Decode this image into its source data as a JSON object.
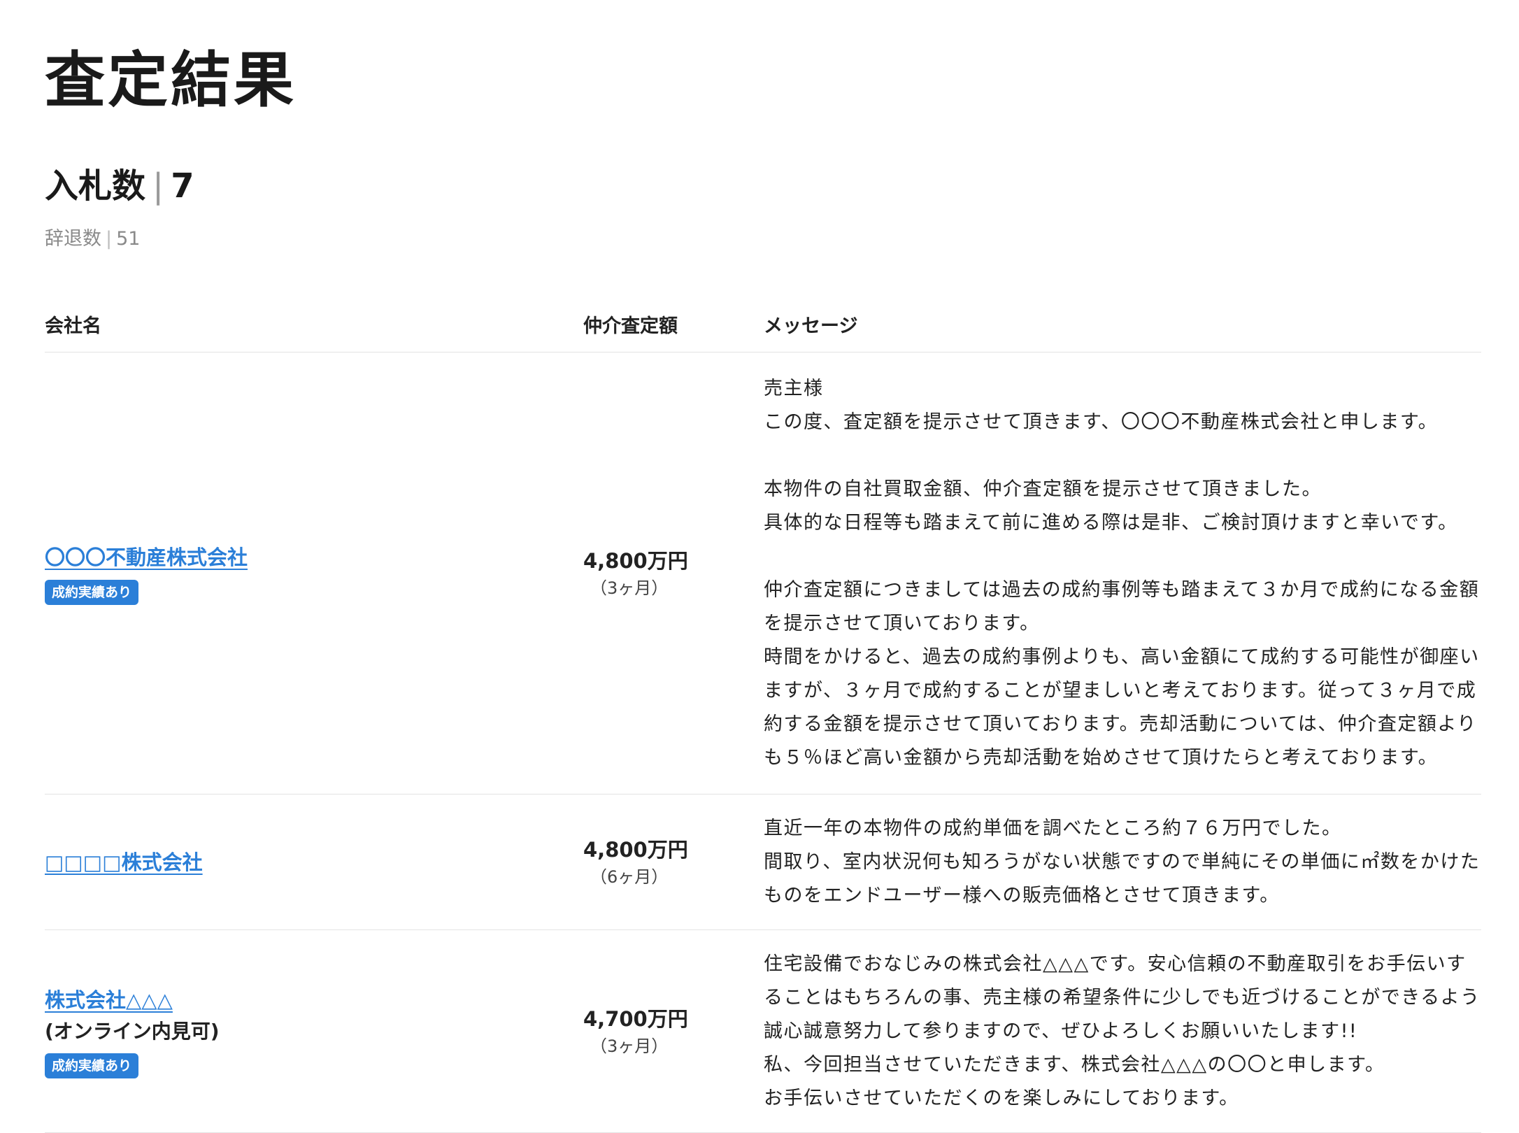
{
  "page": {
    "title": "査定結果",
    "bid_count_label": "入札数",
    "bid_count_value": "7",
    "decline_count_label": "辞退数",
    "decline_count_value": "51"
  },
  "table": {
    "headers": {
      "company": "会社名",
      "price": "仲介査定額",
      "message": "メッセージ"
    },
    "rows": [
      {
        "company": "〇〇〇不動産株式会社",
        "note": "",
        "badge": "成約実績あり",
        "price": "4,800万円",
        "period": "（3ヶ月）",
        "message": "売主様\nこの度、査定額を提示させて頂きます、〇〇〇不動産株式会社と申します。\n\n本物件の自社買取金額、仲介査定額を提示させて頂きました。\n具体的な日程等も踏まえて前に進める際は是非、ご検討頂けますと幸いです。\n\n仲介査定額につきましては過去の成約事例等も踏まえて３か月で成約になる金額\nを提示させて頂いております。\n時間をかけると、過去の成約事例よりも、高い金額にて成約する可能性が御座い\nますが、３ヶ月で成約することが望ましいと考えております。従って３ヶ月で成\n約する金額を提示させて頂いております。売却活動については、仲介査定額より\nも５％ほど高い金額から売却活動を始めさせて頂けたらと考えております。"
      },
      {
        "company": "□□□□株式会社",
        "note": "",
        "badge": "",
        "price": "4,800万円",
        "period": "（6ヶ月）",
        "message": "直近一年の本物件の成約単価を調べたところ約７６万円でした。\n間取り、室内状況何も知ろうがない状態ですので単純にその単価に㎡数をかけた\nものをエンドユーザー様への販売価格とさせて頂きます。"
      },
      {
        "company": "株式会社△△△",
        "note": "(オンライン内見可)",
        "badge": "成約実績あり",
        "price": "4,700万円",
        "period": "（3ヶ月）",
        "message": "住宅設備でおなじみの株式会社△△△です。安心信頼の不動産取引をお手伝いす\nることはもちろんの事、売主様の希望条件に少しでも近づけることができるよう\n誠心誠意努力して参りますので、ぜひよろしくお願いいたします!!\n私、今回担当させていただきます、株式会社△△△の〇〇と申します。\nお手伝いさせていただくのを楽しみにしております。"
      }
    ]
  }
}
